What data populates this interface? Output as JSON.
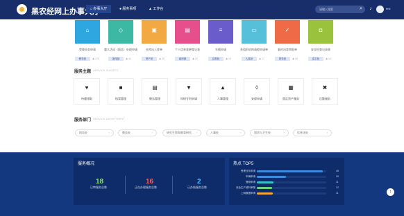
{
  "header": {
    "title": "黑农经网上办事大厅",
    "nav": [
      {
        "label": "办事大厅",
        "icon": "home-icon",
        "active": true
      },
      {
        "label": "服务事项",
        "icon": "location-pin-icon",
        "active": false
      },
      {
        "label": "工作台",
        "icon": "person-icon",
        "active": false
      }
    ],
    "search_placeholder": "请输入搜索",
    "user_name": "test"
  },
  "cards": [
    {
      "label": "受理业务申请",
      "tag": "教务处",
      "views": "175",
      "color": "#2ea7e0",
      "icon": "building-icon"
    },
    {
      "label": "重大活动（报告）处理申请",
      "tag": "宣传部",
      "views": "41",
      "color": "#3db9a3",
      "icon": "bell-icon"
    },
    {
      "label": "仓库出入库单",
      "tag": "资产处",
      "views": "25",
      "color": "#f2a843",
      "icon": "box-icon"
    },
    {
      "label": "个人信息变更登记表",
      "tag": "组织部",
      "views": "20",
      "color": "#e64f8c",
      "icon": "calendar-icon"
    },
    {
      "label": "车辆申请",
      "tag": "后勤处",
      "views": "19",
      "color": "#6a5ccb",
      "icon": "list-icon"
    },
    {
      "label": "多组织机构请假申请单",
      "tag": "人事处",
      "views": "17",
      "color": "#56c0da",
      "icon": "window-icon"
    },
    {
      "label": "临时出差审批单",
      "tag": "财务处",
      "views": "15",
      "color": "#ef6b48",
      "icon": "check-icon"
    },
    {
      "label": "安全检查记录表",
      "tag": "保卫处",
      "views": "14",
      "color": "#9bc23c",
      "icon": "lock-icon"
    }
  ],
  "services": {
    "title": "服务主题",
    "subtitle": "SERVICE SUBJECT",
    "items": [
      {
        "label": "待遇领取",
        "icon": "heart-icon"
      },
      {
        "label": "档案管理",
        "icon": "folder-icon"
      },
      {
        "label": "教务管理",
        "icon": "clipboard-icon"
      },
      {
        "label": "科研专利申请",
        "icon": "flask-icon"
      },
      {
        "label": "人事管理",
        "icon": "graduation-cap-icon"
      },
      {
        "label": "安保申请",
        "icon": "shield-icon"
      },
      {
        "label": "固定资产服务",
        "icon": "building-icon"
      },
      {
        "label": "后勤服务",
        "icon": "tools-icon"
      }
    ]
  },
  "departments": {
    "title": "服务部门",
    "subtitle": "SERVICE DEPARTMENT",
    "items": [
      "财务处",
      "教务处",
      "研究生院和教育研究…",
      "人事处",
      "国资与卫生处",
      "信息化处"
    ]
  },
  "overview": {
    "title": "服务概况",
    "stats": [
      {
        "value": "18",
        "label": "已审服务总数",
        "color": "#8fe06c"
      },
      {
        "value": "16",
        "label": "正在办理服务总数",
        "color": "#ff5a5a"
      },
      {
        "value": "2",
        "label": "已办结服务总数",
        "color": "#5bb7ff"
      }
    ]
  },
  "tops": {
    "title": "热点 TOP5",
    "items": [
      {
        "label": "受理业务申请",
        "count": 45,
        "ratio": 0.95,
        "color": "#3d8be0"
      },
      {
        "label": "车辆申请",
        "count": 20,
        "ratio": 0.42,
        "color": "#3d8be0"
      },
      {
        "label": "借物申请",
        "count": 11,
        "ratio": 0.24,
        "color": "#36c1c8"
      },
      {
        "label": "安全生产资料审核",
        "count": 12,
        "ratio": 0.22,
        "color": "#6ad27a"
      },
      {
        "label": "上网数据申请",
        "count": 11,
        "ratio": 0.23,
        "color": "#f2a843"
      }
    ]
  }
}
